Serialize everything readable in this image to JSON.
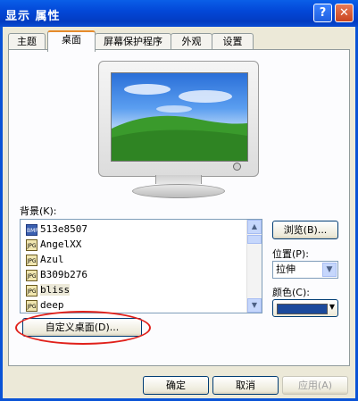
{
  "window": {
    "title": "显示 属性"
  },
  "titlebar_buttons": {
    "help": "?",
    "close": "✕"
  },
  "tabs": [
    {
      "label": "主题"
    },
    {
      "label": "桌面"
    },
    {
      "label": "屏幕保护程序"
    },
    {
      "label": "外观"
    },
    {
      "label": "设置"
    }
  ],
  "active_tab": "桌面",
  "background": {
    "label": "背景(K):",
    "items": [
      {
        "name": "513e8507",
        "icon": "bmp-file-icon"
      },
      {
        "name": "AngelXX",
        "icon": "jpg-file-icon"
      },
      {
        "name": "Azul",
        "icon": "jpg-file-icon"
      },
      {
        "name": "B309b276",
        "icon": "jpg-file-icon"
      },
      {
        "name": "bliss",
        "icon": "jpg-file-icon",
        "selected": true
      },
      {
        "name": "deep",
        "icon": "jpg-file-icon"
      }
    ]
  },
  "browse_label": "浏览(B)...",
  "position": {
    "label": "位置(P):",
    "value": "拉伸"
  },
  "color": {
    "label": "颜色(C):",
    "value": "#1c4a9c"
  },
  "customize_label": "自定义桌面(D)...",
  "footer": {
    "ok": "确定",
    "cancel": "取消",
    "apply": "应用(A)"
  }
}
